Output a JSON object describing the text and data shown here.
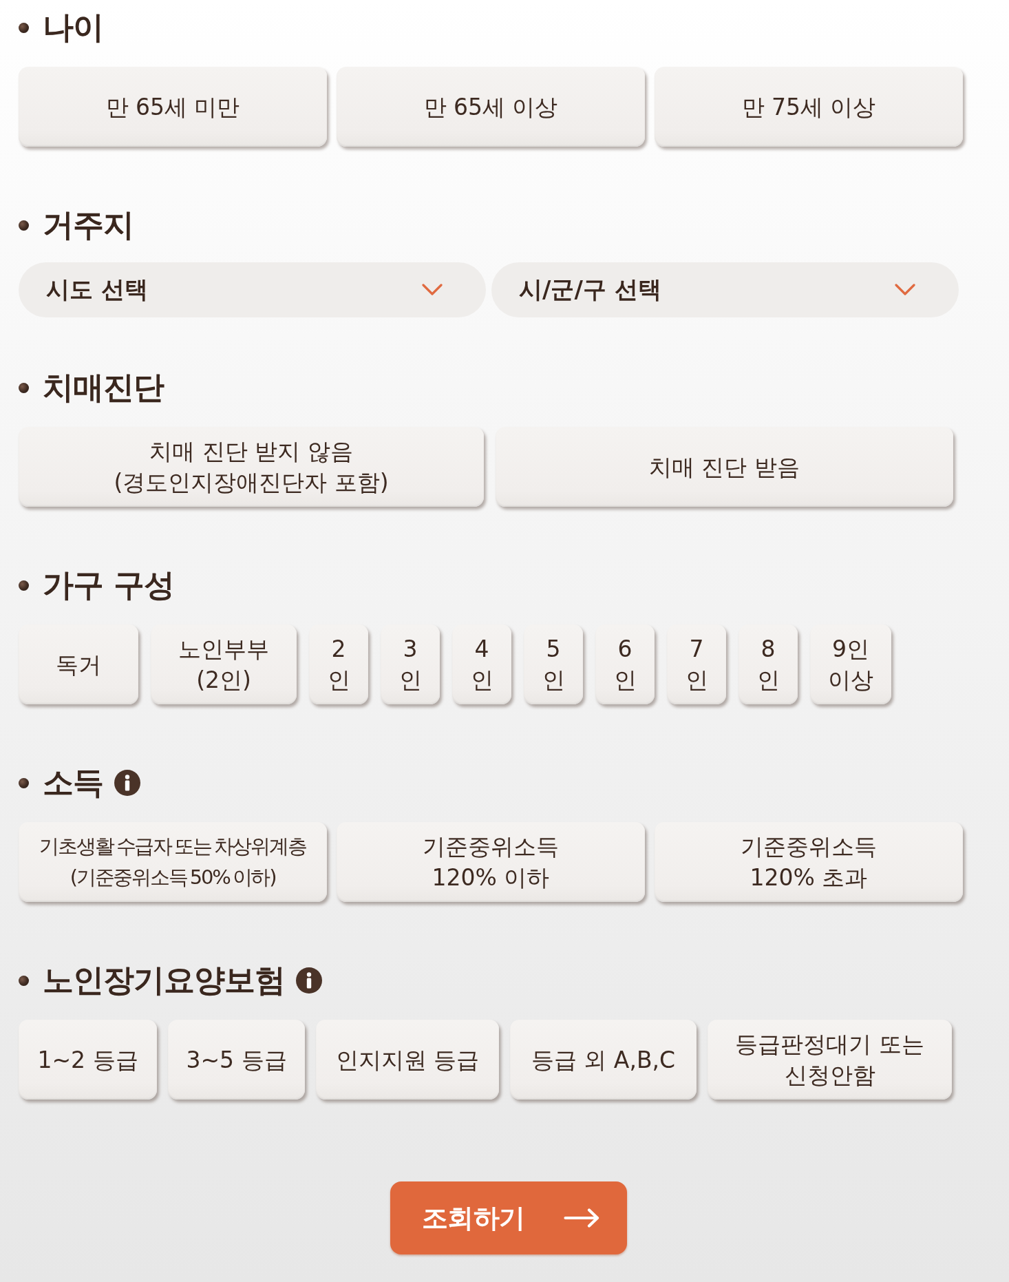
{
  "sections": [
    {
      "title": "나이",
      "kind": "options",
      "info": false,
      "options": [
        {
          "lines": [
            "만 65세 미만"
          ],
          "selected": false
        },
        {
          "lines": [
            "만 65세 이상"
          ],
          "selected": false
        },
        {
          "lines": [
            "만 75세 이상"
          ],
          "selected": false
        }
      ]
    },
    {
      "title": "거주지",
      "kind": "selects",
      "info": false,
      "selects": [
        {
          "placeholder": "시도 선택"
        },
        {
          "placeholder": "시/군/구 선택"
        }
      ]
    },
    {
      "title": "치매진단",
      "kind": "options",
      "info": false,
      "options": [
        {
          "lines": [
            "치매 진단 받지 않음",
            "(경도인지장애진단자 포함)"
          ],
          "selected": false
        },
        {
          "lines": [
            "치매 진단 받음"
          ],
          "selected": false
        }
      ]
    },
    {
      "title": "가구 구성",
      "kind": "options",
      "info": false,
      "options": [
        {
          "lines": [
            "독거"
          ],
          "selected": false
        },
        {
          "lines": [
            "노인부부",
            "(2인)"
          ],
          "selected": false
        },
        {
          "lines": [
            "2",
            "인"
          ],
          "selected": false
        },
        {
          "lines": [
            "3",
            "인"
          ],
          "selected": false
        },
        {
          "lines": [
            "4",
            "인"
          ],
          "selected": false
        },
        {
          "lines": [
            "5",
            "인"
          ],
          "selected": false
        },
        {
          "lines": [
            "6",
            "인"
          ],
          "selected": false
        },
        {
          "lines": [
            "7",
            "인"
          ],
          "selected": false
        },
        {
          "lines": [
            "8",
            "인"
          ],
          "selected": false
        },
        {
          "lines": [
            "9인",
            "이상"
          ],
          "selected": false
        }
      ]
    },
    {
      "title": "소득",
      "kind": "options",
      "info": true,
      "options": [
        {
          "lines": [
            "기초생활 수급자 또는 차상위계층",
            "(기준중위소득 50% 이하)"
          ],
          "selected": false
        },
        {
          "lines": [
            "기준중위소득",
            "120% 이하"
          ],
          "selected": false
        },
        {
          "lines": [
            "기준중위소득",
            "120% 초과"
          ],
          "selected": false
        }
      ]
    },
    {
      "title": "노인장기요양보험",
      "kind": "options",
      "info": true,
      "options": [
        {
          "lines": [
            "1~2 등급"
          ],
          "selected": false
        },
        {
          "lines": [
            "3~5 등급"
          ],
          "selected": false
        },
        {
          "lines": [
            "인지지원 등급"
          ],
          "selected": false
        },
        {
          "lines": [
            "등급 외 A,B,C"
          ],
          "selected": false
        },
        {
          "lines": [
            "등급판정대기 또는",
            "신청안함"
          ],
          "selected": false
        }
      ]
    }
  ],
  "submit": {
    "label": "조회하기"
  }
}
